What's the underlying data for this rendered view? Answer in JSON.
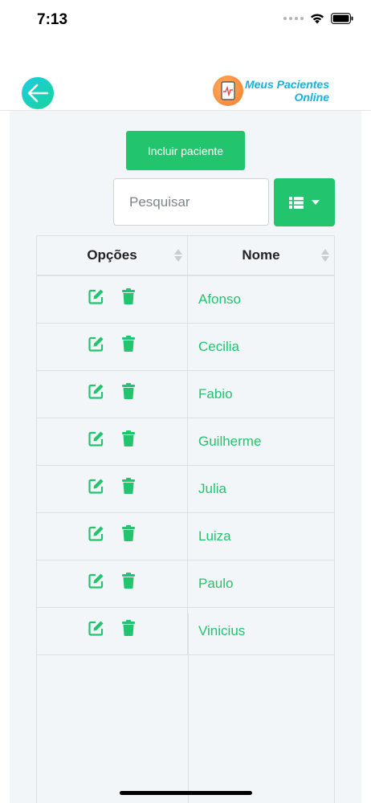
{
  "status_bar": {
    "time": "7:13"
  },
  "header": {
    "logo_line1": "Meus Pacientes",
    "logo_line2": "Online",
    "back_icon": "arrow-left-icon",
    "accent_gradient": [
      "#1ecbe1",
      "#18d59a"
    ],
    "logo_text_color": "#12b4dd"
  },
  "toolbar": {
    "add_label": "Incluir paciente",
    "search_placeholder": "Pesquisar",
    "search_value": "",
    "columns_icon": "list-columns-icon"
  },
  "table": {
    "headers": [
      "Opções",
      "Nome"
    ],
    "rows": [
      {
        "name": "Afonso"
      },
      {
        "name": "Cecilia"
      },
      {
        "name": "Fabio"
      },
      {
        "name": "Guilherme"
      },
      {
        "name": "Julia"
      },
      {
        "name": "Luiza"
      },
      {
        "name": "Paulo"
      },
      {
        "name": "Vinicius"
      }
    ]
  },
  "colors": {
    "brand_green": "#22c46e",
    "panel_bg": "#f3f6f9"
  }
}
